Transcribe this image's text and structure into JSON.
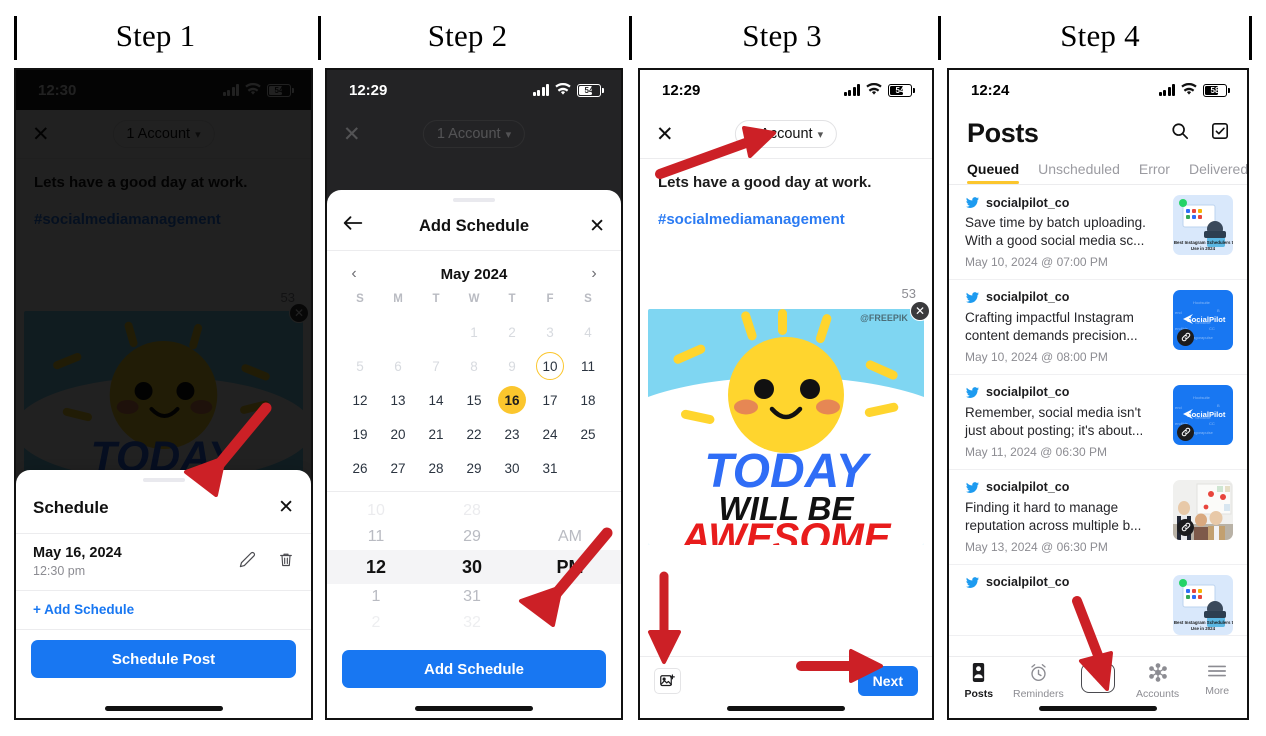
{
  "steps": [
    {
      "label": "Step 1"
    },
    {
      "label": "Step 2"
    },
    {
      "label": "Step 3"
    },
    {
      "label": "Step 4"
    }
  ],
  "colors": {
    "primary_blue": "#1877f2",
    "accent_yellow": "#fbc62d",
    "arrow_red": "#cc2026",
    "dark_bg": "#232325",
    "link_blue": "#2b7bf3"
  },
  "step1": {
    "status": {
      "time": "12:30",
      "battery": "54"
    },
    "composer": {
      "close_icon": "close-icon",
      "account_label": "1 Account",
      "chevron": "⌄",
      "body_text": "Lets have a good day at work.",
      "hashtag": "#socialmediamanagement",
      "char_count": "53"
    },
    "sheet": {
      "title": "Schedule",
      "close_label": "✕",
      "date": "May 16, 2024",
      "time": "12:30 pm",
      "add_schedule": "+ Add Schedule",
      "primary_button": "Schedule Post"
    }
  },
  "step2": {
    "status": {
      "time": "12:29",
      "battery": "54"
    },
    "behind": {
      "close_icon": "close-icon",
      "account_label": "1 Account"
    },
    "modal": {
      "back_icon": "back-arrow-icon",
      "title": "Add Schedule",
      "close_label": "✕",
      "calendar": {
        "month_label": "May 2024",
        "prev": "‹",
        "next": "›",
        "dow": [
          "S",
          "M",
          "T",
          "W",
          "T",
          "F",
          "S"
        ],
        "leading_blanks": 3,
        "days": [
          1,
          2,
          3,
          4,
          5,
          6,
          7,
          8,
          9,
          10,
          11,
          12,
          13,
          14,
          15,
          16,
          17,
          18,
          19,
          20,
          21,
          22,
          23,
          24,
          25,
          26,
          27,
          28,
          29,
          30,
          31
        ],
        "disabled_through": 9,
        "today": 10,
        "selected": 16
      },
      "timepicker": {
        "rows_above": {
          "hour": "11",
          "minute": "29",
          "period": "AM"
        },
        "selected": {
          "hour": "12",
          "minute": "30",
          "period": "PM"
        },
        "rows_below": {
          "hour": "1",
          "minute": "31"
        }
      },
      "primary_button": "Add Schedule"
    }
  },
  "step3": {
    "status": {
      "time": "12:29",
      "battery": "54"
    },
    "composer": {
      "close_icon": "close-icon",
      "account_label": "1 Account",
      "body_text": "Lets have a good day at work.",
      "hashtag": "#socialmediamanagement",
      "char_count": "53",
      "media_alt": "TODAY WILL BE AWESOME sun illustration",
      "media_lines": [
        "TODAY",
        "WILL BE",
        "AWESOME"
      ],
      "remove_media_label": "✕",
      "add_image_icon": "add-image-icon",
      "next_button": "Next"
    }
  },
  "step4": {
    "status": {
      "time": "12:24",
      "battery": "58"
    },
    "header": {
      "title": "Posts",
      "search_icon": "search-icon",
      "select_icon": "checkbox-select-icon"
    },
    "tabs": [
      {
        "label": "Queued",
        "active": true
      },
      {
        "label": "Unscheduled",
        "active": false
      },
      {
        "label": "Error",
        "active": false
      },
      {
        "label": "Delivered",
        "active": false
      }
    ],
    "posts": [
      {
        "handle": "socialpilot_co",
        "text": "Save time by batch uploading. With a good social media sc...",
        "date": "May 10, 2024 @ 07:00 PM",
        "thumb": "instagram-schedulers-article",
        "thumb_caption": "3 Best Instagram Schedulers to Use in 2024"
      },
      {
        "handle": "socialpilot_co",
        "text": "Crafting impactful Instagram content demands precision...",
        "date": "May 10, 2024 @ 08:00 PM",
        "thumb": "socialpilot-brand-card",
        "thumb_caption": "SocialPilot"
      },
      {
        "handle": "socialpilot_co",
        "text": "Remember, social media isn't just about posting; it's about...",
        "date": "May 11, 2024 @ 06:30 PM",
        "thumb": "socialpilot-brand-card",
        "thumb_caption": "SocialPilot"
      },
      {
        "handle": "socialpilot_co",
        "text": "Finding it hard to manage reputation across multiple b...",
        "date": "May 13, 2024 @ 06:30 PM",
        "thumb": "business-meeting-photo",
        "thumb_caption": ""
      },
      {
        "handle": "socialpilot_co",
        "text": "",
        "date": "",
        "thumb": "instagram-schedulers-article",
        "thumb_caption": ""
      }
    ],
    "tabbar": [
      {
        "label": "Posts",
        "icon": "posts-icon",
        "active": true
      },
      {
        "label": "Reminders",
        "icon": "alarm-clock-icon",
        "active": false
      },
      {
        "label": "",
        "icon": "plus-icon",
        "active": false
      },
      {
        "label": "Accounts",
        "icon": "accounts-network-icon",
        "active": false
      },
      {
        "label": "More",
        "icon": "hamburger-menu-icon",
        "active": false
      }
    ]
  }
}
